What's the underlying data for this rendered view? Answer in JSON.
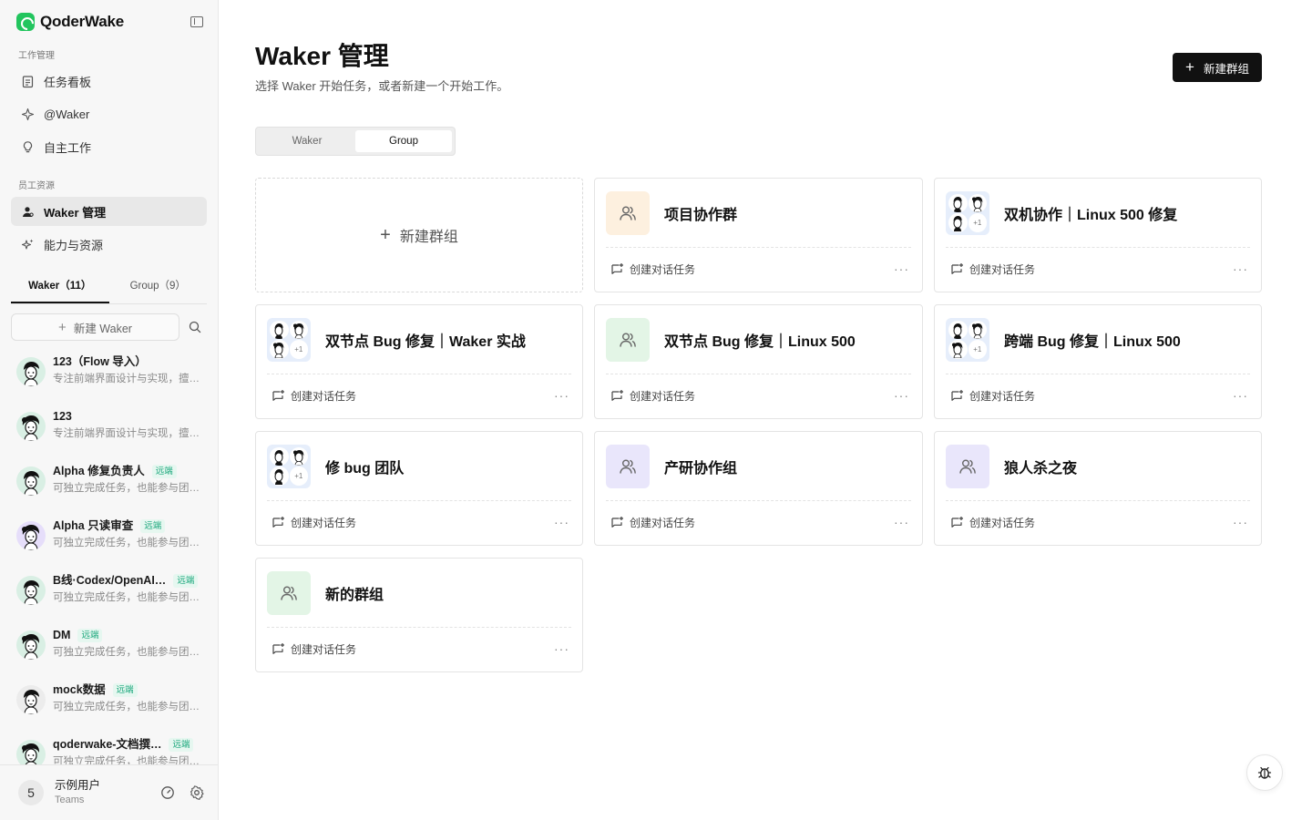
{
  "app": {
    "name": "QoderWake"
  },
  "sidebar": {
    "section_work": "工作管理",
    "nav_work": [
      {
        "label": "任务看板",
        "icon": "clipboard-icon"
      },
      {
        "label": "@Waker",
        "icon": "sparkle-icon"
      },
      {
        "label": "自主工作",
        "icon": "bulb-icon"
      }
    ],
    "section_staff": "员工资源",
    "nav_staff": [
      {
        "label": "Waker 管理",
        "icon": "person-icon",
        "active": true
      },
      {
        "label": "能力与资源",
        "icon": "stars-icon"
      }
    ],
    "tabs": [
      {
        "label": "Waker（11）",
        "active": true
      },
      {
        "label": "Group（9）",
        "active": false
      }
    ],
    "new_waker": "新建 Waker",
    "wakers": [
      {
        "name": "123（Flow 导入）",
        "desc": "专注前端界面设计与实现，擅长…",
        "badge": ""
      },
      {
        "name": "123",
        "desc": "专注前端界面设计与实现，擅长…",
        "badge": ""
      },
      {
        "name": "Alpha 修复负责人",
        "desc": "可独立完成任务，也能参与团队…",
        "badge": "远端"
      },
      {
        "name": "Alpha 只读审查",
        "desc": "可独立完成任务，也能参与团队…",
        "badge": "远端"
      },
      {
        "name": "B线·Codex/OpenAI…",
        "desc": "可独立完成任务，也能参与团队…",
        "badge": "远端"
      },
      {
        "name": "DM",
        "desc": "可独立完成任务，也能参与团队…",
        "badge": "远端"
      },
      {
        "name": "mock数据",
        "desc": "可独立完成任务，也能参与团队…",
        "badge": "远端"
      },
      {
        "name": "qoderwake-文档撰…",
        "desc": "可独立完成任务，也能参与团队…",
        "badge": "远端"
      }
    ],
    "user": {
      "avatar_text": "5",
      "name": "示例用户",
      "team": "Teams"
    }
  },
  "main": {
    "title": "Waker 管理",
    "subtitle": "选择 Waker 开始任务，或者新建一个开始工作。",
    "new_group_button": "新建群组",
    "segments": [
      {
        "label": "Waker",
        "active": false
      },
      {
        "label": "Group",
        "active": true
      }
    ],
    "new_group_card": "新建群组",
    "create_task_label": "创建对话任务",
    "more_label": "···",
    "groups": [
      {
        "title": "项目协作群",
        "icon_type": "single",
        "icon_bg": "#fdf0df"
      },
      {
        "title": "双机协作｜Linux 500 修复",
        "icon_type": "stack",
        "extra": "+1"
      },
      {
        "title": "双节点 Bug 修复｜Waker 实战",
        "icon_type": "stack",
        "extra": "+1"
      },
      {
        "title": "双节点 Bug 修复｜Linux 500",
        "icon_type": "single",
        "icon_bg": "#e3f5e6"
      },
      {
        "title": "跨端 Bug 修复｜Linux 500",
        "icon_type": "stack",
        "extra": "+1"
      },
      {
        "title": "修 bug 团队",
        "icon_type": "stack",
        "extra": "+1"
      },
      {
        "title": "产研协作组",
        "icon_type": "single",
        "icon_bg": "#e9e6fb"
      },
      {
        "title": "狼人杀之夜",
        "icon_type": "single",
        "icon_bg": "#e9e6fb"
      },
      {
        "title": "新的群组",
        "icon_type": "single",
        "icon_bg": "#e3f5e6"
      }
    ]
  },
  "colors": {
    "primary": "#111111",
    "remote_badge": "#18a67a",
    "sidebar_bg": "#f7f7f7"
  }
}
